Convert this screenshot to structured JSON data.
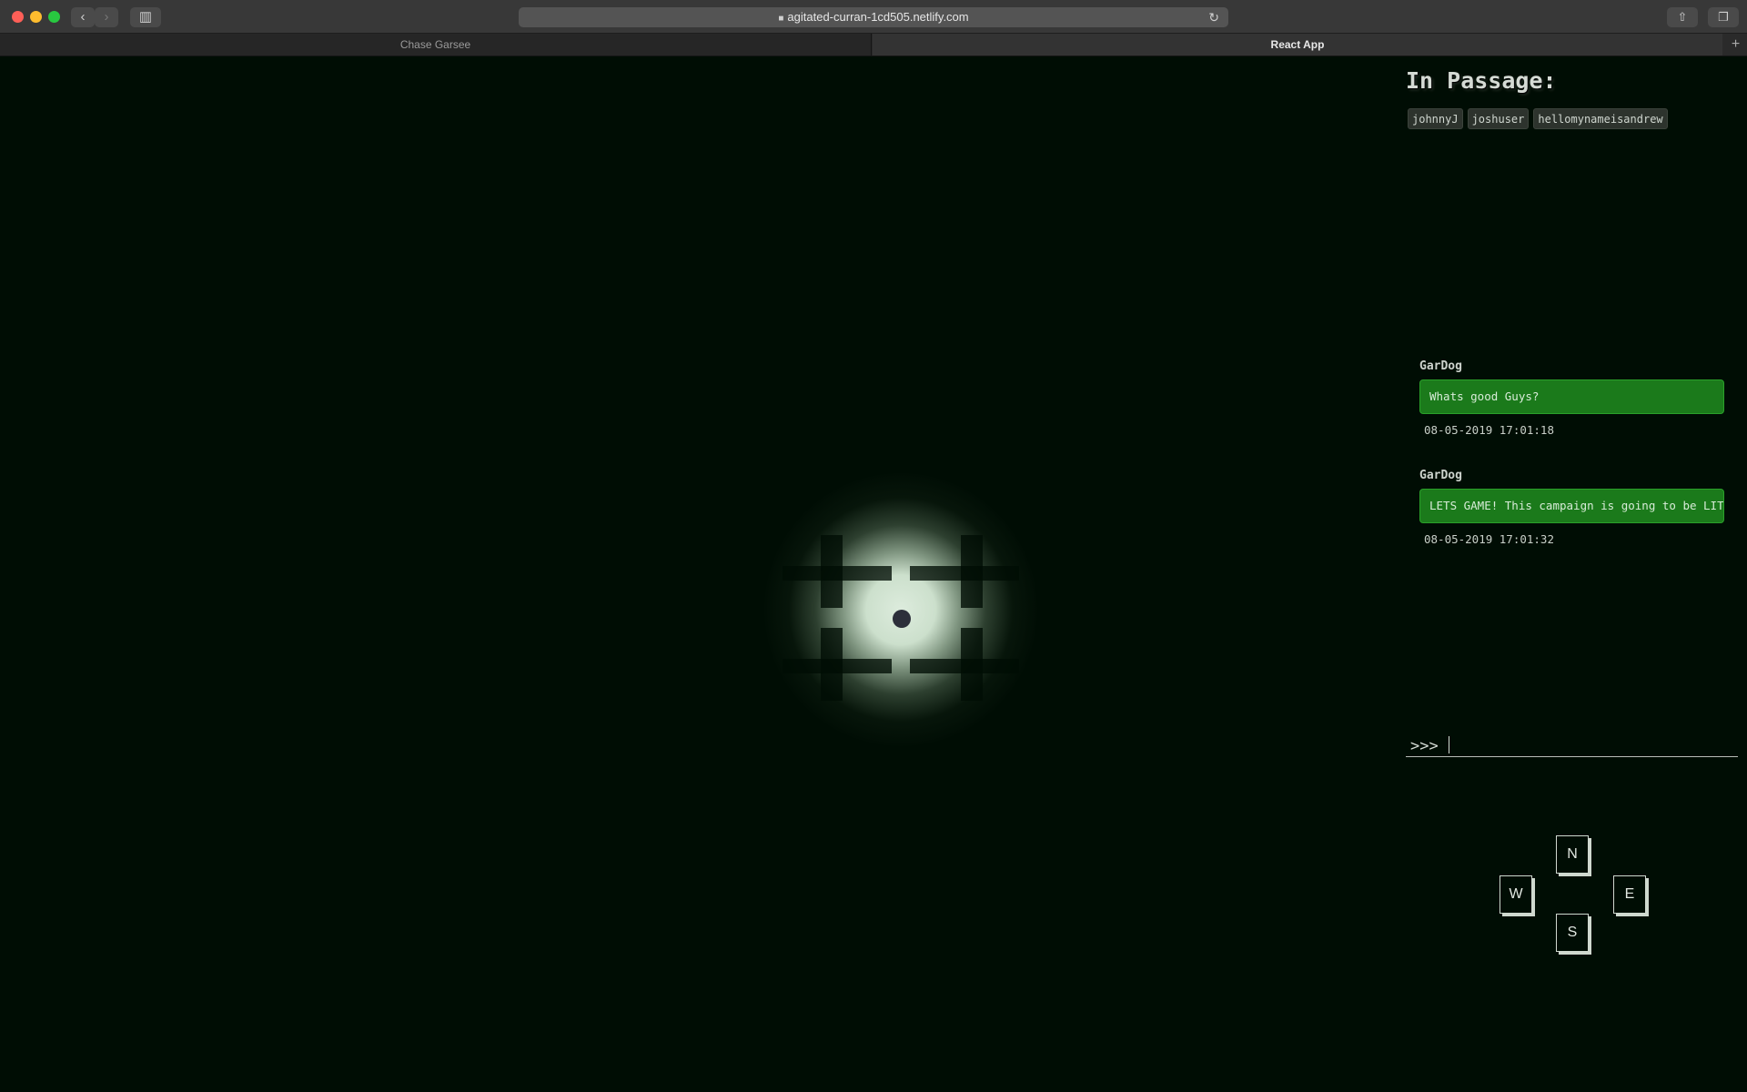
{
  "browser": {
    "url": "agitated-curran-1cd505.netlify.com",
    "tabs": [
      {
        "title": "Chase Garsee",
        "active": false
      },
      {
        "title": "React App",
        "active": true
      }
    ]
  },
  "icons": {
    "back": "chevron-left-icon",
    "forward": "chevron-right-icon",
    "sidebar": "sidebar-icon",
    "lock": "lock-icon",
    "reload": "reload-icon",
    "share": "share-icon",
    "tab_overview": "tab-overview-icon",
    "new_tab": "plus-icon"
  },
  "game": {
    "passage_title": "In Passage:",
    "players_in_passage": [
      "johnnyJ",
      "joshuser",
      "hellomynameisandrew"
    ],
    "messages": [
      {
        "author": "GarDog",
        "text": "Whats good Guys?",
        "timestamp": "08-05-2019 17:01:18"
      },
      {
        "author": "GarDog",
        "text": "LETS GAME! This campaign is going to be LIT",
        "timestamp": "08-05-2019 17:01:32"
      }
    ],
    "prompt": ">>>",
    "input_value": "",
    "directions": {
      "north": "N",
      "west": "W",
      "east": "E",
      "south": "S"
    }
  },
  "colors": {
    "background": "#000d04",
    "message_bubble": "#1b7a1b",
    "text": "#d5dbd5"
  }
}
